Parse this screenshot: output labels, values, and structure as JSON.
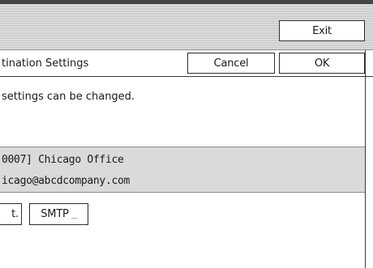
{
  "header": {
    "exit_label": "Exit"
  },
  "dialog": {
    "title": "tination Settings",
    "cancel_label": "Cancel",
    "ok_label": "OK",
    "info": "settings can be changed."
  },
  "entry": {
    "name": "0007] Chicago Office",
    "email": "icago@abcdcompany.com"
  },
  "buttons": {
    "ext_label": "t.",
    "smtp_label": "SMTP",
    "smtp_suffix": "..."
  }
}
